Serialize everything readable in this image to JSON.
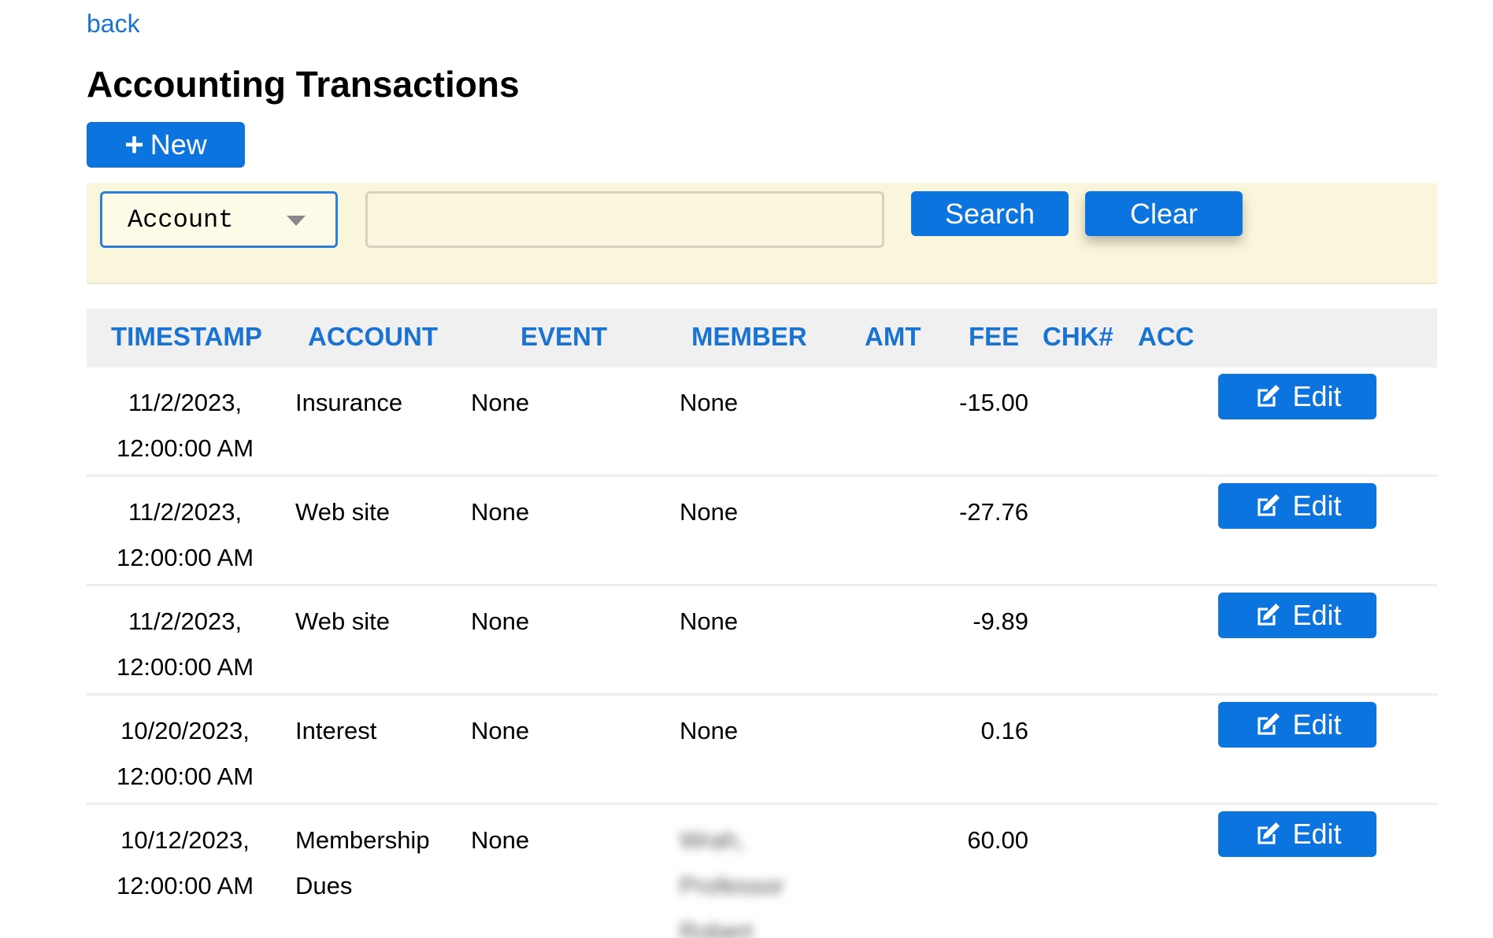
{
  "nav": {
    "back_label": "back"
  },
  "page": {
    "title": "Accounting Transactions"
  },
  "toolbar": {
    "new_label": "New"
  },
  "search": {
    "field_selected": "Account",
    "query_value": "",
    "search_label": "Search",
    "clear_label": "Clear"
  },
  "table": {
    "headers": [
      "TIMESTAMP",
      "ACCOUNT",
      "EVENT",
      "MEMBER",
      "AMT",
      "FEE",
      "CHK#",
      "ACC"
    ],
    "edit_label": "Edit",
    "rows": [
      {
        "date": "11/2/2023,",
        "time": "12:00:00 AM",
        "account": [
          "Insurance"
        ],
        "event": "None",
        "member": [
          "None"
        ],
        "member_blurred": false,
        "amt": "-15.00"
      },
      {
        "date": "11/2/2023,",
        "time": "12:00:00 AM",
        "account": [
          "Web site"
        ],
        "event": "None",
        "member": [
          "None"
        ],
        "member_blurred": false,
        "amt": "-27.76"
      },
      {
        "date": "11/2/2023,",
        "time": "12:00:00 AM",
        "account": [
          "Web site"
        ],
        "event": "None",
        "member": [
          "None"
        ],
        "member_blurred": false,
        "amt": "-9.89"
      },
      {
        "date": "10/20/2023,",
        "time": "12:00:00 AM",
        "account": [
          "Interest"
        ],
        "event": "None",
        "member": [
          "None"
        ],
        "member_blurred": false,
        "amt": "0.16"
      },
      {
        "date": "10/12/2023,",
        "time": "12:00:00 AM",
        "account": [
          "Membership",
          "Dues"
        ],
        "event": "None",
        "member": [
          "Wrah,",
          "Professor",
          "Robert"
        ],
        "member_blurred": true,
        "amt": "60.00"
      }
    ]
  },
  "colors": {
    "accent": "#0b74de",
    "link": "#1a73d1",
    "search_bar_bg": "#faf6dc",
    "header_bg": "#f0f0f0"
  },
  "icons": {
    "new": "plus-icon",
    "edit": "edit-icon",
    "select": "caret-down-icon"
  }
}
